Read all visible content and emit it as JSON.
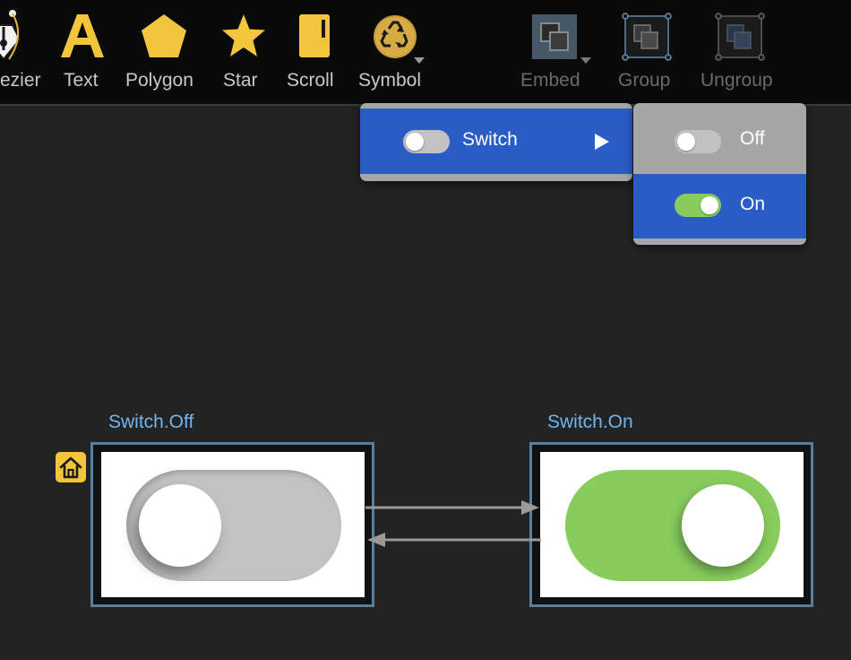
{
  "toolbar": {
    "tools": [
      {
        "id": "bezier",
        "label": "ezier",
        "icon": "pen-nib-icon"
      },
      {
        "id": "text",
        "label": "Text",
        "icon": "letter-a-icon"
      },
      {
        "id": "polygon",
        "label": "Polygon",
        "icon": "pentagon-icon"
      },
      {
        "id": "star",
        "label": "Star",
        "icon": "star-icon"
      },
      {
        "id": "scroll",
        "label": "Scroll",
        "icon": "scroll-icon"
      },
      {
        "id": "symbol",
        "label": "Symbol",
        "icon": "recycle-icon"
      },
      {
        "id": "embed",
        "label": "Embed",
        "icon": "embed-icon"
      },
      {
        "id": "group",
        "label": "Group",
        "icon": "group-icon"
      },
      {
        "id": "ungroup",
        "label": "Ungroup",
        "icon": "ungroup-icon"
      }
    ]
  },
  "symbol_menu": {
    "items": [
      {
        "label": "Switch",
        "has_submenu": true
      }
    ]
  },
  "switch_submenu": {
    "items": [
      {
        "label": "Off",
        "state": "off"
      },
      {
        "label": "On",
        "state": "on",
        "highlighted": true
      }
    ]
  },
  "canvas": {
    "states": [
      {
        "title": "Switch.Off",
        "switch_state": "off",
        "is_home": true
      },
      {
        "title": "Switch.On",
        "switch_state": "on",
        "is_home": false
      }
    ]
  },
  "colors": {
    "toolbar_bg": "#0a0a0a",
    "canvas_bg": "#232323",
    "menu_highlight": "#2a5cc6",
    "menu_gray": "#a6a6a6",
    "switch_on": "#88cc5e",
    "switch_off": "#c2c2c2",
    "state_title": "#6db6f2",
    "tool_gold": "#f2c53d"
  }
}
